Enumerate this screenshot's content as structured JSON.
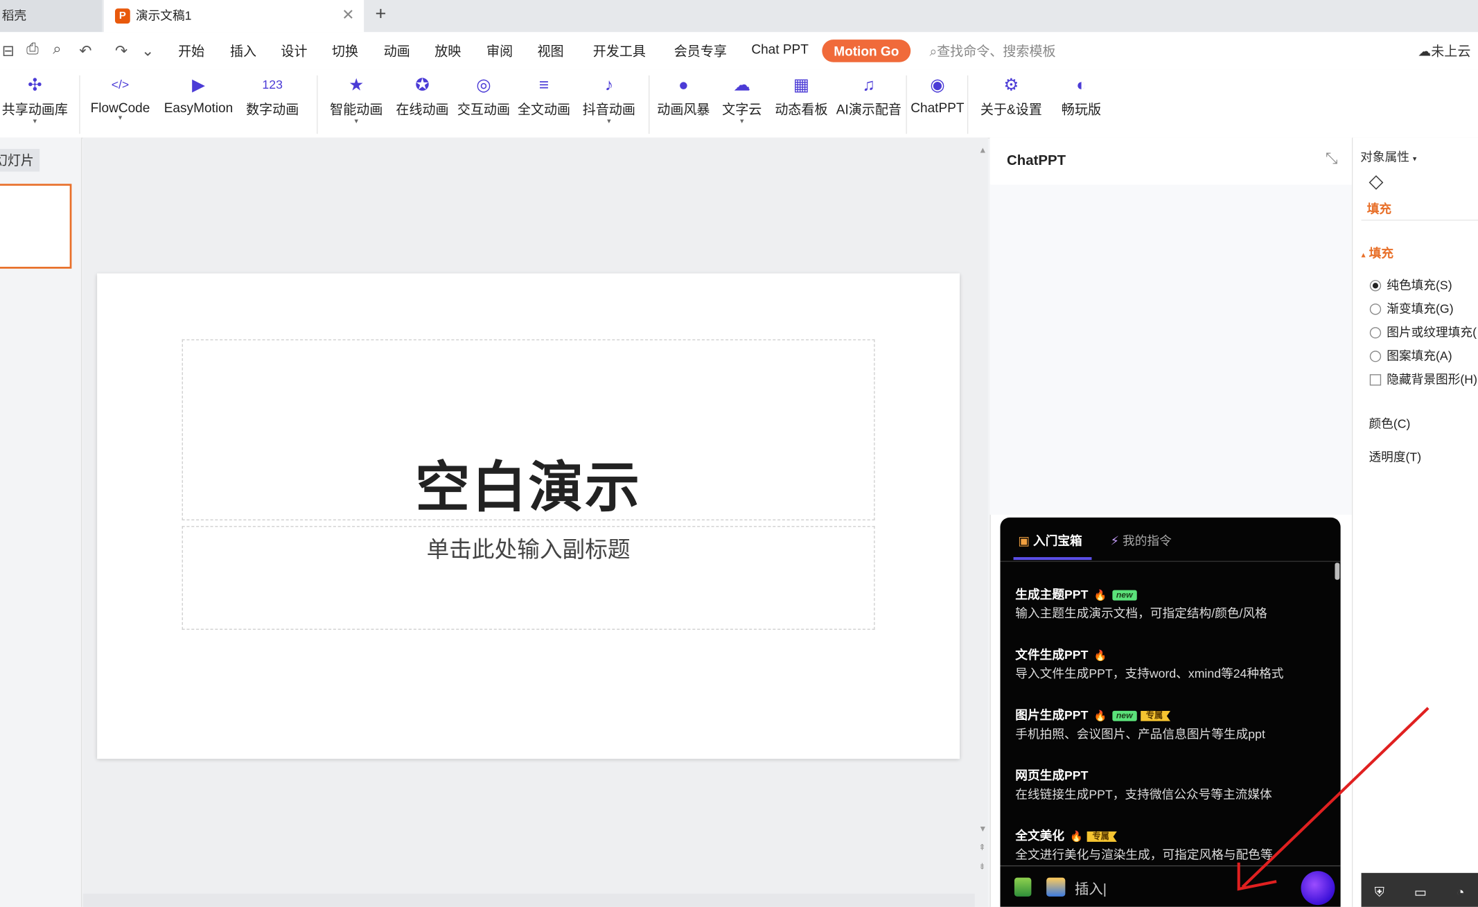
{
  "tabs": {
    "prev_tab": "稻壳",
    "active_tab": "演示文稿1",
    "active_icon": "P",
    "close": "✕",
    "add": "+"
  },
  "quick_access": [
    "⊟",
    "⎙",
    "⌕",
    "↶",
    "↷",
    "⌄"
  ],
  "menu": {
    "items": [
      "开始",
      "插入",
      "设计",
      "切换",
      "动画",
      "放映",
      "审阅",
      "视图",
      "开发工具",
      "会员专享",
      "Chat PPT"
    ],
    "motion_go": "Motion Go",
    "search_placeholder": "查找命令、搜索模板",
    "cloud_status": "未上云"
  },
  "ribbon": [
    {
      "label": "共享动画库",
      "icon": "share-nodes-icon",
      "glyph": "✣",
      "dropdown": true
    },
    {
      "label": "FlowCode",
      "icon": "code-icon",
      "glyph": "</>",
      "dropdown": true
    },
    {
      "label": "EasyMotion",
      "icon": "video-icon",
      "glyph": "▶",
      "dropdown": false
    },
    {
      "label": "数字动画",
      "icon": "number-icon",
      "glyph": "123",
      "dropdown": false
    },
    {
      "label": "智能动画",
      "icon": "star-icon",
      "glyph": "★",
      "dropdown": true
    },
    {
      "label": "在线动画",
      "icon": "star-box-icon",
      "glyph": "✪",
      "dropdown": false
    },
    {
      "label": "交互动画",
      "icon": "pointer-icon",
      "glyph": "◎",
      "dropdown": false
    },
    {
      "label": "全文动画",
      "icon": "list-star-icon",
      "glyph": "≡",
      "dropdown": false
    },
    {
      "label": "抖音动画",
      "icon": "tiktok-icon",
      "glyph": "♪",
      "dropdown": true
    },
    {
      "label": "动画风暴",
      "icon": "head-icon",
      "glyph": "●",
      "dropdown": false
    },
    {
      "label": "文字云",
      "icon": "text-cloud-icon",
      "glyph": "☁",
      "dropdown": true
    },
    {
      "label": "动态看板",
      "icon": "dashboard-icon",
      "glyph": "▦",
      "dropdown": false
    },
    {
      "label": "AI演示配音",
      "icon": "audio-wave-icon",
      "glyph": "♫",
      "dropdown": false
    },
    {
      "label": "ChatPPT",
      "icon": "chatppt-logo-icon",
      "glyph": "◉",
      "dropdown": false
    },
    {
      "label": "关于&设置",
      "icon": "settings-icon",
      "glyph": "⚙",
      "dropdown": false
    },
    {
      "label": "畅玩版",
      "icon": "toggle-icon",
      "glyph": "◐",
      "dropdown": false
    }
  ],
  "thumbnails": {
    "label": "幻灯片"
  },
  "slide": {
    "title": "空白演示",
    "subtitle": "单击此处输入副标题"
  },
  "chat_panel": {
    "title": "ChatPPT",
    "tab_active": "入门宝箱",
    "tab_other": "我的指令",
    "features": [
      {
        "title": "生成主题PPT",
        "desc": "输入主题生成演示文档，可指定结构/颜色/风格",
        "fire": true,
        "new": true,
        "vip": false
      },
      {
        "title": "文件生成PPT",
        "desc": "导入文件生成PPT，支持word、xmind等24种格式",
        "fire": true,
        "new": false,
        "vip": false
      },
      {
        "title": "图片生成PPT",
        "desc": "手机拍照、会议图片、产品信息图片等生成ppt",
        "fire": true,
        "new": true,
        "vip": true
      },
      {
        "title": "网页生成PPT",
        "desc": "在线链接生成PPT，支持微信公众号等主流媒体",
        "fire": false,
        "new": false,
        "vip": false
      },
      {
        "title": "全文美化",
        "desc": "全文进行美化与渲染生成，可指定风格与配色等",
        "fire": true,
        "new": false,
        "vip": true
      }
    ],
    "badge_new": "new",
    "badge_vip": "专属",
    "input_placeholder": "插入|"
  },
  "properties": {
    "header": "对象属性",
    "tab": "填充",
    "section": "填充",
    "options": [
      {
        "label": "纯色填充(S)",
        "type": "radio",
        "checked": true
      },
      {
        "label": "渐变填充(G)",
        "type": "radio",
        "checked": false
      },
      {
        "label": "图片或纹理填充(",
        "type": "radio",
        "checked": false
      },
      {
        "label": "图案填充(A)",
        "type": "radio",
        "checked": false
      },
      {
        "label": "隐藏背景图形(H)",
        "type": "checkbox",
        "checked": false
      }
    ],
    "color_label": "颜色(C)",
    "transparency_label": "透明度(T)"
  },
  "colors": {
    "accent_orange": "#e8702a",
    "motion_go": "#f06a3a",
    "ribbon_icon": "#4b3bd6",
    "annotation": "#e02020"
  }
}
